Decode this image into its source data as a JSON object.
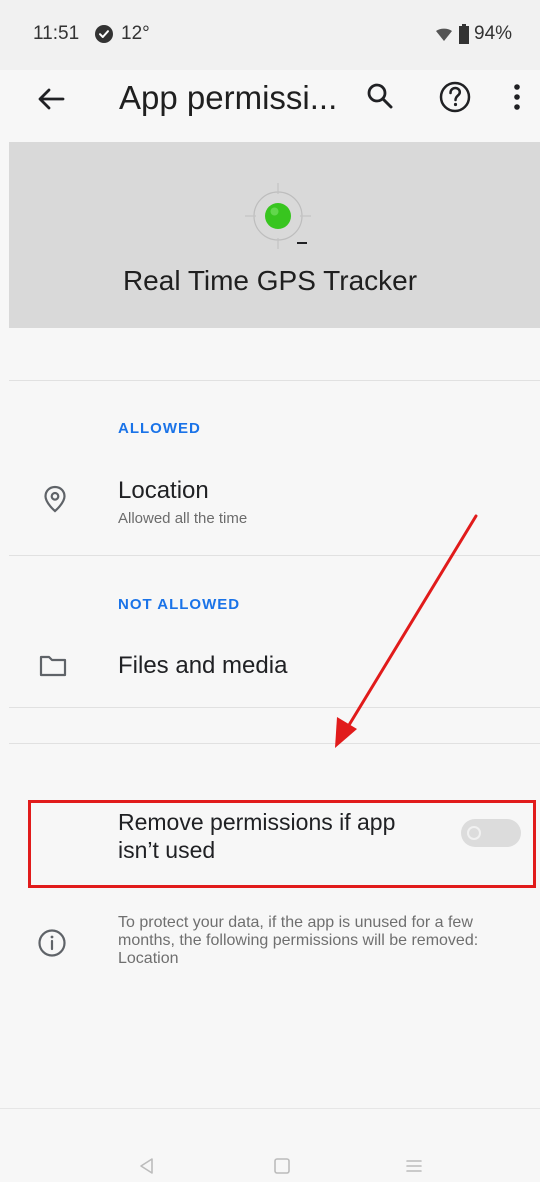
{
  "status_bar": {
    "time": "11:51",
    "temperature": "12°",
    "battery": "94%"
  },
  "app_bar": {
    "title": "App permissi..."
  },
  "app": {
    "name": "Real Time GPS Tracker"
  },
  "allowed": {
    "header": "ALLOWED",
    "items": [
      {
        "title": "Location",
        "subtitle": "Allowed all the time"
      }
    ]
  },
  "not_allowed": {
    "header": "NOT ALLOWED",
    "items": [
      {
        "title": "Files and media"
      }
    ]
  },
  "remove_permissions": {
    "label": "Remove permissions if app isn’t used",
    "enabled": false
  },
  "info": {
    "text": "To protect your data, if the app is unused for a few months, the following permissions will be removed: Location"
  },
  "colors": {
    "accent": "#1a73e8",
    "annotation": "#e11b1b",
    "app_icon": "#38c51f"
  },
  "icons": {
    "status": [
      "check-circle-icon",
      "wifi-icon",
      "battery-icon"
    ],
    "app_bar": [
      "back-arrow-icon",
      "search-icon",
      "help-icon",
      "more-icon"
    ],
    "permissions": [
      "location-pin-icon",
      "folder-icon",
      "info-icon"
    ],
    "navigation": [
      "nav-back-icon",
      "nav-home-icon",
      "nav-recents-icon"
    ]
  }
}
